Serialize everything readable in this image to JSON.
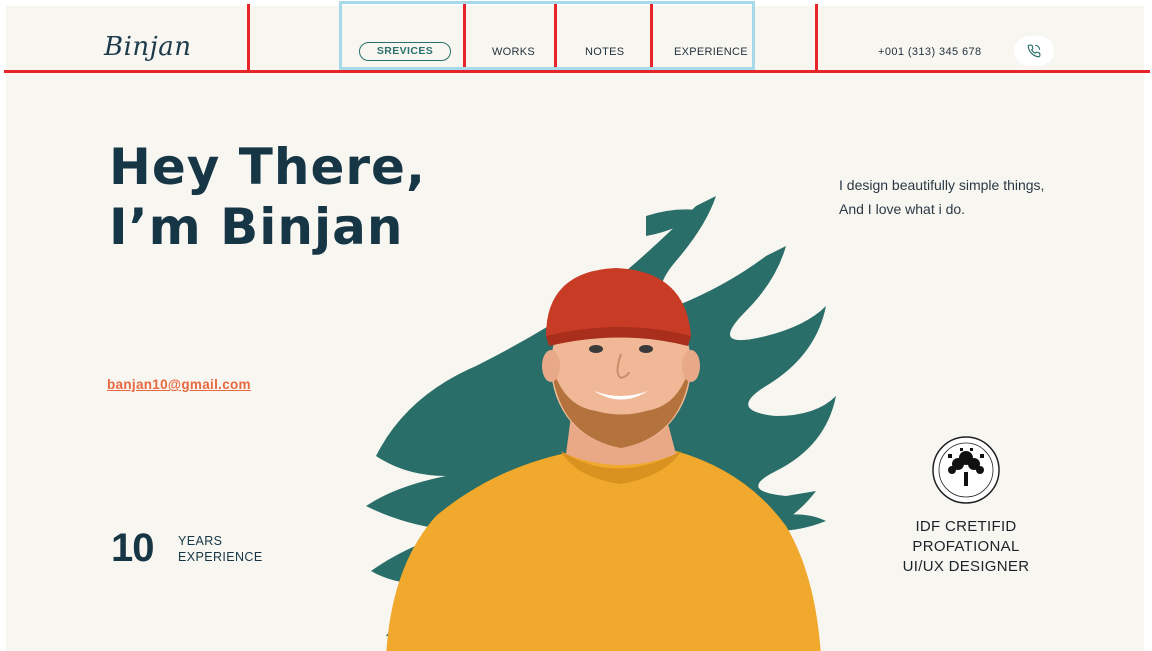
{
  "header": {
    "logo": "Binjan",
    "nav": [
      {
        "label": "SREVICES",
        "active": true
      },
      {
        "label": "WORKS"
      },
      {
        "label": "NOTES"
      },
      {
        "label": "EXPERIENCE"
      }
    ],
    "phone": "+001 (313) 345 678",
    "phone_icon": "phone-icon"
  },
  "hero": {
    "title_line1": "Hey There,",
    "title_line2": "I’m Binjan",
    "tagline": "I design beautifully simple things, And I love what i do.",
    "email": "banjan10@gmail.com",
    "years_number": "10",
    "years_label1": "YEARS",
    "years_label2": "EXPERIENCE",
    "cert_line1": "IDF CRETIFID",
    "cert_line2": "PROFATIONAL",
    "cert_line3": "UI/UX DESIGNER"
  },
  "colors": {
    "background": "#f8f6f1",
    "navy": "#163645",
    "teal": "#2b6f6a",
    "accent_orange": "#e8683f",
    "annotation_red": "#e8242b",
    "annotation_blue": "#a6d9ea",
    "sweater": "#f0a92c",
    "beanie": "#c83b25"
  }
}
